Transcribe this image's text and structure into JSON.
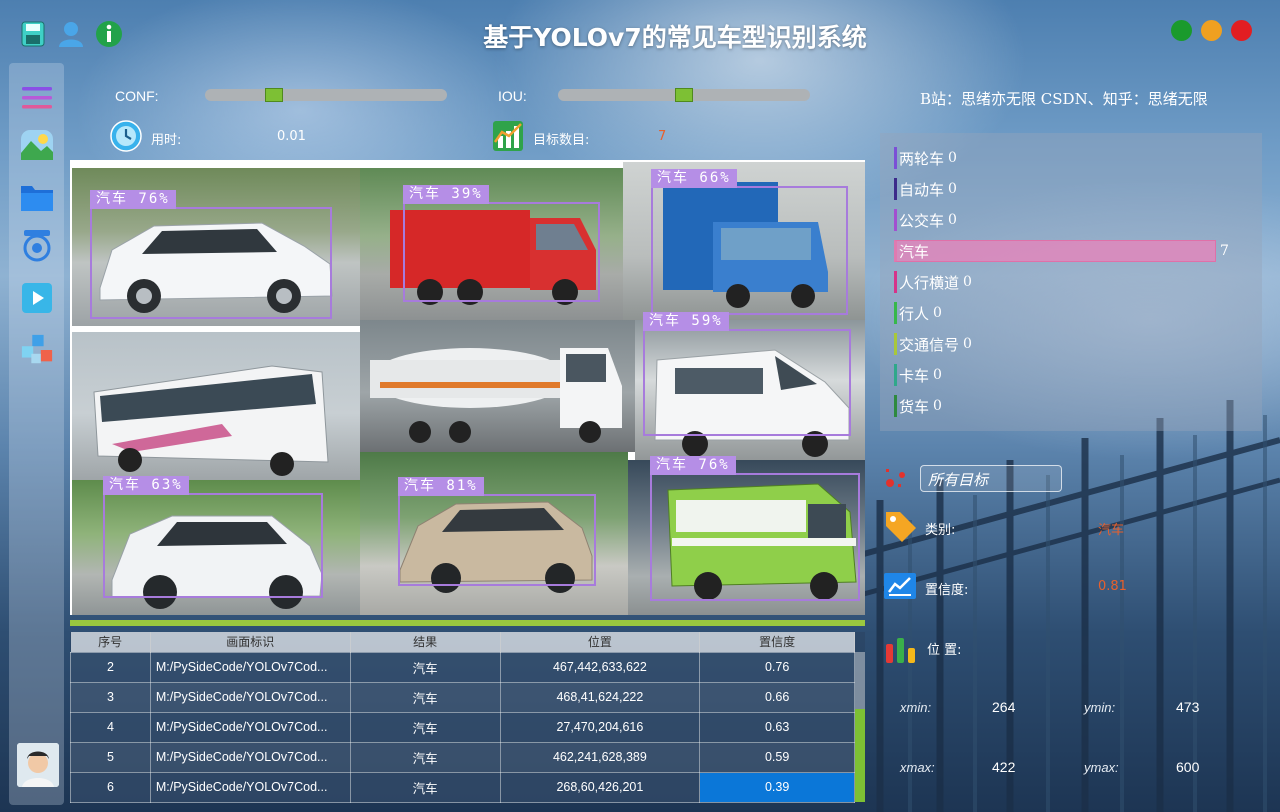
{
  "app": {
    "title": "基于YOLOv7的常见车型识别系统"
  },
  "window_controls": [
    "#1a9a2c",
    "#f0a020",
    "#e21e22"
  ],
  "params": {
    "conf_label": "CONF:",
    "iou_label": "IOU:",
    "conf_level": 0.27,
    "iou_level": 0.5,
    "credit": "B站：思绪亦无限  CSDN、知乎：思绪无限"
  },
  "stats": {
    "time_label": "用时:",
    "time_value": "0.01",
    "count_label": "目标数目:",
    "count_value": "7"
  },
  "detections": [
    {
      "label": "汽车  76%"
    },
    {
      "label": "汽车  39%"
    },
    {
      "label": "汽车  66%"
    },
    {
      "label": "汽车  59%"
    },
    {
      "label": "汽车  63%"
    },
    {
      "label": "汽车  81%"
    },
    {
      "label": "汽车  76%"
    }
  ],
  "table": {
    "headers": [
      "序号",
      "画面标识",
      "结果",
      "位置",
      "置信度"
    ],
    "rows": [
      [
        "2",
        "M:/PySideCode/YOLOv7Cod...",
        "汽车",
        "467,442,633,622",
        "0.76"
      ],
      [
        "3",
        "M:/PySideCode/YOLOv7Cod...",
        "汽车",
        "468,41,624,222",
        "0.66"
      ],
      [
        "4",
        "M:/PySideCode/YOLOv7Cod...",
        "汽车",
        "27,470,204,616",
        "0.63"
      ],
      [
        "5",
        "M:/PySideCode/YOLOv7Cod...",
        "汽车",
        "462,241,628,389",
        "0.59"
      ],
      [
        "6",
        "M:/PySideCode/YOLOv7Cod...",
        "汽车",
        "268,60,426,201",
        "0.39"
      ]
    ]
  },
  "classes": [
    {
      "name": "两轮车",
      "count": "0",
      "color": "#7b4fd6"
    },
    {
      "name": "自动车",
      "count": "0",
      "color": "#3c2a8a"
    },
    {
      "name": "公交车",
      "count": "0",
      "color": "#a24fd0"
    },
    {
      "name": "汽车",
      "count": "7",
      "color": "#e07ab0"
    },
    {
      "name": "人行横道",
      "count": "0",
      "color": "#d6338a"
    },
    {
      "name": "行人",
      "count": "0",
      "color": "#36b84a"
    },
    {
      "name": "交通信号",
      "count": "0",
      "color": "#a8c83a"
    },
    {
      "name": "卡车",
      "count": "0",
      "color": "#2fa88a"
    },
    {
      "name": "货车",
      "count": "0",
      "color": "#2e8a3e"
    }
  ],
  "selection": {
    "target_select": "所有目标",
    "category_label": "类别:",
    "category_value": "汽车",
    "confidence_label": "置信度:",
    "confidence_value": "0.81",
    "position_label": "位 置:",
    "xmin_label": "xmin:",
    "xmin": "264",
    "ymin_label": "ymin:",
    "ymin": "473",
    "xmax_label": "xmax:",
    "xmax": "422",
    "ymax_label": "ymax:",
    "ymax": "600"
  }
}
